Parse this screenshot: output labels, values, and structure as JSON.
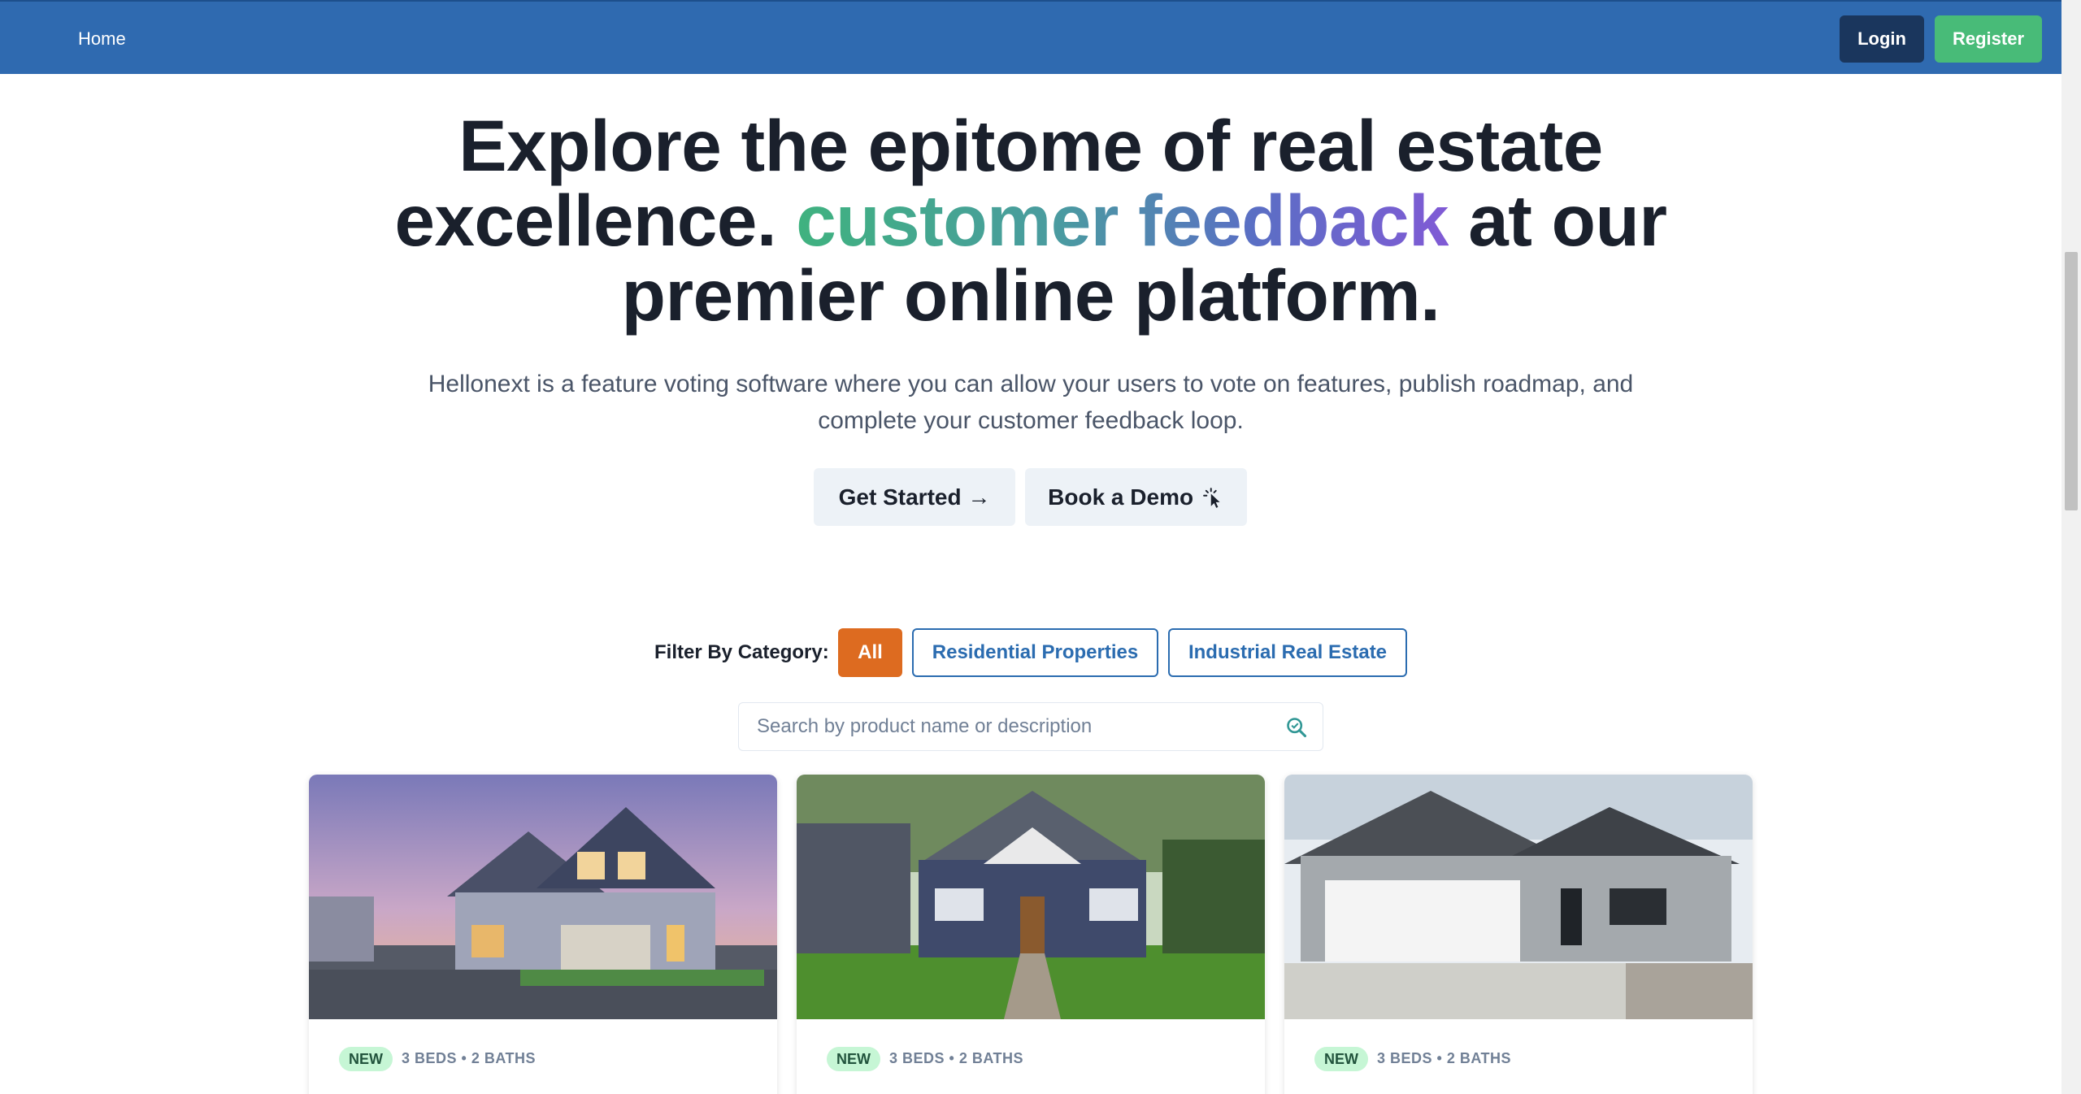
{
  "navbar": {
    "home_label": "Home",
    "login_label": "Login",
    "register_label": "Register",
    "colors": {
      "background": "#2f6ab0",
      "login": "#1a365d",
      "register": "#48bb78"
    }
  },
  "hero": {
    "title_line_1": "Explore the epitome of real estate",
    "title_before_highlight": "excellence. ",
    "title_highlight": "customer feedback",
    "title_after_highlight": " at our",
    "title_line_3": "premier online platform.",
    "subtitle": "Hellonext is a feature voting software where you can allow your users to vote on features, publish roadmap, and complete your customer feedback loop.",
    "get_started_label": "Get Started →",
    "book_demo_label": "Book a Demo",
    "book_demo_icon": "pointer-click-icon"
  },
  "filter": {
    "label": "Filter By Category:",
    "categories": [
      "All",
      "Residential Properties",
      "Industrial Real Estate"
    ],
    "active": "All",
    "colors": {
      "active": "#dd6b20",
      "outline": "#2b6cb0"
    }
  },
  "search": {
    "placeholder": "Search by product name or description",
    "value": "",
    "icon": "search-icon"
  },
  "listings": [
    {
      "badge": "NEW",
      "meta": "3 BEDS • 2 BATHS",
      "image": "two-story house at dusk"
    },
    {
      "badge": "NEW",
      "meta": "3 BEDS • 2 BATHS",
      "image": "navy craftsman house with lawn"
    },
    {
      "badge": "NEW",
      "meta": "3 BEDS • 2 BATHS",
      "image": "gray ranch house with garage"
    }
  ]
}
